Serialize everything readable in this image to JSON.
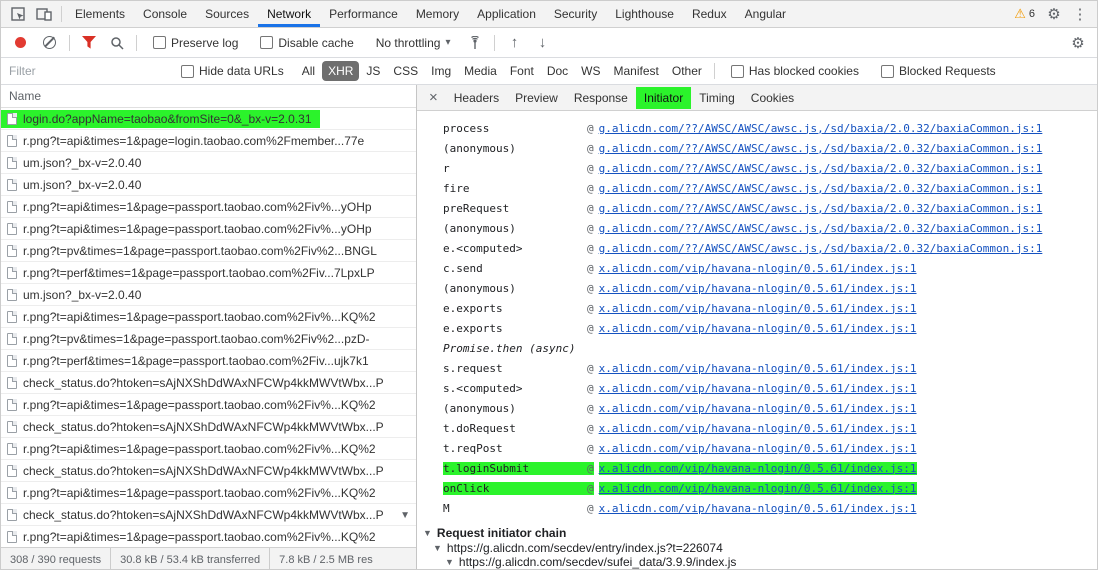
{
  "top_bar": {
    "tabs": [
      "Elements",
      "Console",
      "Sources",
      "Network",
      "Performance",
      "Memory",
      "Application",
      "Security",
      "Lighthouse",
      "Redux",
      "Angular"
    ],
    "active_tab": "Network",
    "warning_count": "6"
  },
  "net_toolbar": {
    "preserve_log_label": "Preserve log",
    "disable_cache_label": "Disable cache",
    "throttling_value": "No throttling"
  },
  "filter_bar": {
    "filter_placeholder": "Filter",
    "hide_data_urls_label": "Hide data URLs",
    "type_filters": [
      "All",
      "XHR",
      "JS",
      "CSS",
      "Img",
      "Media",
      "Font",
      "Doc",
      "WS",
      "Manifest",
      "Other"
    ],
    "active_type_filter": "XHR",
    "has_blocked_cookies_label": "Has blocked cookies",
    "blocked_requests_label": "Blocked Requests"
  },
  "requests_panel": {
    "column_header": "Name",
    "rows": [
      {
        "name": "login.do?appName=taobao&fromSite=0&_bx-v=2.0.31",
        "highlighted": true
      },
      {
        "name": "r.png?t=api&times=1&page=login.taobao.com%2Fmember...77e",
        "highlighted": false
      },
      {
        "name": "um.json?_bx-v=2.0.40",
        "highlighted": false
      },
      {
        "name": "um.json?_bx-v=2.0.40",
        "highlighted": false
      },
      {
        "name": "r.png?t=api&times=1&page=passport.taobao.com%2Fiv%...yOHp",
        "highlighted": false
      },
      {
        "name": "r.png?t=api&times=1&page=passport.taobao.com%2Fiv%...yOHp",
        "highlighted": false
      },
      {
        "name": "r.png?t=pv&times=1&page=passport.taobao.com%2Fiv%2...BNGL",
        "highlighted": false
      },
      {
        "name": "r.png?t=perf&times=1&page=passport.taobao.com%2Fiv...7LpxLP",
        "highlighted": false
      },
      {
        "name": "um.json?_bx-v=2.0.40",
        "highlighted": false
      },
      {
        "name": "r.png?t=api&times=1&page=passport.taobao.com%2Fiv%...KQ%2",
        "highlighted": false
      },
      {
        "name": "r.png?t=pv&times=1&page=passport.taobao.com%2Fiv%2...pzD-",
        "highlighted": false
      },
      {
        "name": "r.png?t=perf&times=1&page=passport.taobao.com%2Fiv...ujk7k1",
        "highlighted": false
      },
      {
        "name": "check_status.do?htoken=sAjNXShDdWAxNFCWp4kkMWVtWbx...P",
        "highlighted": false
      },
      {
        "name": "r.png?t=api&times=1&page=passport.taobao.com%2Fiv%...KQ%2",
        "highlighted": false
      },
      {
        "name": "check_status.do?htoken=sAjNXShDdWAxNFCWp4kkMWVtWbx...P",
        "highlighted": false
      },
      {
        "name": "r.png?t=api&times=1&page=passport.taobao.com%2Fiv%...KQ%2",
        "highlighted": false
      },
      {
        "name": "check_status.do?htoken=sAjNXShDdWAxNFCWp4kkMWVtWbx...P",
        "highlighted": false
      },
      {
        "name": "r.png?t=api&times=1&page=passport.taobao.com%2Fiv%...KQ%2",
        "highlighted": false
      },
      {
        "name": "check_status.do?htoken=sAjNXShDdWAxNFCWp4kkMWVtWbx...P",
        "highlighted": false
      },
      {
        "name": "r.png?t=api&times=1&page=passport.taobao.com%2Fiv%...KQ%2",
        "highlighted": false
      }
    ]
  },
  "details_panel": {
    "close_label": "×",
    "tabs": [
      "Headers",
      "Preview",
      "Response",
      "Initiator",
      "Timing",
      "Cookies"
    ],
    "active_tab": "Initiator",
    "at_separator": "@",
    "stack_frames": [
      {
        "fn": "process",
        "url": "g.alicdn.com/??/AWSC/AWSC/awsc.js,/sd/baxia/2.0.32/baxiaCommon.js:1"
      },
      {
        "fn": "(anonymous)",
        "url": "g.alicdn.com/??/AWSC/AWSC/awsc.js,/sd/baxia/2.0.32/baxiaCommon.js:1"
      },
      {
        "fn": "r",
        "url": "g.alicdn.com/??/AWSC/AWSC/awsc.js,/sd/baxia/2.0.32/baxiaCommon.js:1"
      },
      {
        "fn": "fire",
        "url": "g.alicdn.com/??/AWSC/AWSC/awsc.js,/sd/baxia/2.0.32/baxiaCommon.js:1"
      },
      {
        "fn": "preRequest",
        "url": "g.alicdn.com/??/AWSC/AWSC/awsc.js,/sd/baxia/2.0.32/baxiaCommon.js:1"
      },
      {
        "fn": "(anonymous)",
        "url": "g.alicdn.com/??/AWSC/AWSC/awsc.js,/sd/baxia/2.0.32/baxiaCommon.js:1"
      },
      {
        "fn": "e.<computed>",
        "url": "g.alicdn.com/??/AWSC/AWSC/awsc.js,/sd/baxia/2.0.32/baxiaCommon.js:1"
      },
      {
        "fn": "c.send",
        "url": "x.alicdn.com/vip/havana-nlogin/0.5.61/index.js:1"
      },
      {
        "fn": "(anonymous)",
        "url": "x.alicdn.com/vip/havana-nlogin/0.5.61/index.js:1"
      },
      {
        "fn": "e.exports",
        "url": "x.alicdn.com/vip/havana-nlogin/0.5.61/index.js:1"
      },
      {
        "fn": "e.exports",
        "url": "x.alicdn.com/vip/havana-nlogin/0.5.61/index.js:1"
      },
      {
        "fn": "Promise.then (async)",
        "async": true
      },
      {
        "fn": "s.request",
        "url": "x.alicdn.com/vip/havana-nlogin/0.5.61/index.js:1"
      },
      {
        "fn": "s.<computed>",
        "url": "x.alicdn.com/vip/havana-nlogin/0.5.61/index.js:1"
      },
      {
        "fn": "(anonymous)",
        "url": "x.alicdn.com/vip/havana-nlogin/0.5.61/index.js:1"
      },
      {
        "fn": "t.doRequest",
        "url": "x.alicdn.com/vip/havana-nlogin/0.5.61/index.js:1"
      },
      {
        "fn": "t.reqPost",
        "url": "x.alicdn.com/vip/havana-nlogin/0.5.61/index.js:1"
      },
      {
        "fn": "t.loginSubmit",
        "url": "x.alicdn.com/vip/havana-nlogin/0.5.61/index.js:1",
        "highlighted": true
      },
      {
        "fn": "onClick",
        "url": "x.alicdn.com/vip/havana-nlogin/0.5.61/index.js:1",
        "highlighted": true
      },
      {
        "fn": "M",
        "url": "x.alicdn.com/vip/havana-nlogin/0.5.61/index.js:1"
      }
    ],
    "initiator_chain": {
      "title": "Request initiator chain",
      "items": [
        "https://g.alicdn.com/secdev/entry/index.js?t=226074",
        "https://g.alicdn.com/secdev/sufei_data/3.9.9/index.js"
      ]
    }
  },
  "status_bar": {
    "requests_summary": "308 / 390 requests",
    "transferred_summary": "30.8 kB / 53.4 kB transferred",
    "resources_summary": "7.8 kB / 2.5 MB res"
  },
  "icons": {
    "warning": "⚠",
    "gear": "⚙",
    "kebab": "⋮",
    "dropdown_caret": "▾",
    "export_arrow": "↑",
    "import_arrow": "↓",
    "expand_triangle": "▼",
    "scroll_down": "▼"
  },
  "colors": {
    "highlight_green": "#2bf32b",
    "link_blue": "#1552c0",
    "accent_blue": "#1a73e8",
    "record_red": "#e23b32",
    "warning_yellow": "#f29900",
    "active_pill_gray": "#6e6e6e"
  }
}
